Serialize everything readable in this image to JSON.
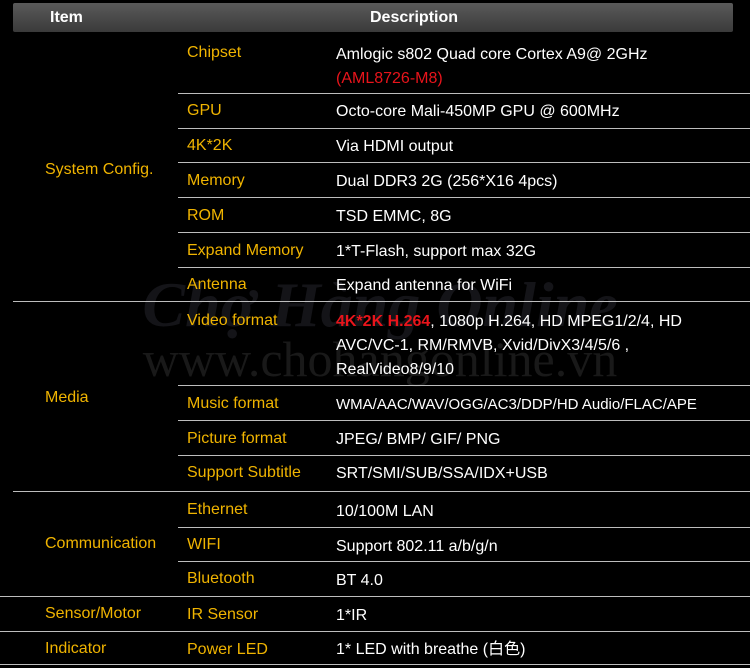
{
  "header": {
    "item": "Item",
    "description": "Description"
  },
  "watermark": {
    "line1": "Chợ Hàng Online",
    "line2": "www.chohangonline.vn"
  },
  "categories": {
    "system": "System Config.",
    "media": "Media",
    "communication": "Communication",
    "sensor": "Sensor/Motor",
    "indicator": "Indicator"
  },
  "rows": {
    "chipset": {
      "feature": "Chipset",
      "desc": "Amlogic s802 Quad core Cortex A9@ 2GHz",
      "desc_red": "(AML8726-M8)"
    },
    "gpu": {
      "feature": "GPU",
      "desc": "Octo-core Mali-450MP GPU @ 600MHz"
    },
    "k4": {
      "feature": "4K*2K",
      "desc": "Via HDMI output"
    },
    "memory": {
      "feature": "Memory",
      "desc": "Dual DDR3 2G (256*X16 4pcs)"
    },
    "rom": {
      "feature": "ROM",
      "desc": "TSD EMMC, 8G"
    },
    "expand": {
      "feature": "Expand Memory",
      "desc": "1*T-Flash, support max 32G"
    },
    "antenna": {
      "feature": "Antenna",
      "desc": "Expand antenna for WiFi"
    },
    "video": {
      "feature": "Video format",
      "desc_red": "4K*2K H.264",
      "desc_line1": ",  1080p H.264, HD MPEG1/2/4, HD",
      "desc_line2": "AVC/VC-1, RM/RMVB, Xvid/DivX3/4/5/6 ,",
      "desc_line3": "RealVideo8/9/10"
    },
    "music": {
      "feature": "Music format",
      "desc": "WMA/AAC/WAV/OGG/AC3/DDP/HD Audio/FLAC/APE"
    },
    "picture": {
      "feature": "Picture format",
      "desc": "JPEG/ BMP/ GIF/ PNG"
    },
    "subtitle": {
      "feature": "Support Subtitle",
      "desc": "SRT/SMI/SUB/SSA/IDX+USB"
    },
    "ethernet": {
      "feature": "Ethernet",
      "desc": "10/100M LAN"
    },
    "wifi": {
      "feature": "WIFI",
      "desc": "Support 802.11 a/b/g/n"
    },
    "bluetooth": {
      "feature": "Bluetooth",
      "desc": "BT 4.0"
    },
    "ir": {
      "feature": "IR Sensor",
      "desc": "1*IR"
    },
    "led": {
      "feature": "Power LED",
      "desc": "1* LED with breathe (白色)"
    }
  }
}
